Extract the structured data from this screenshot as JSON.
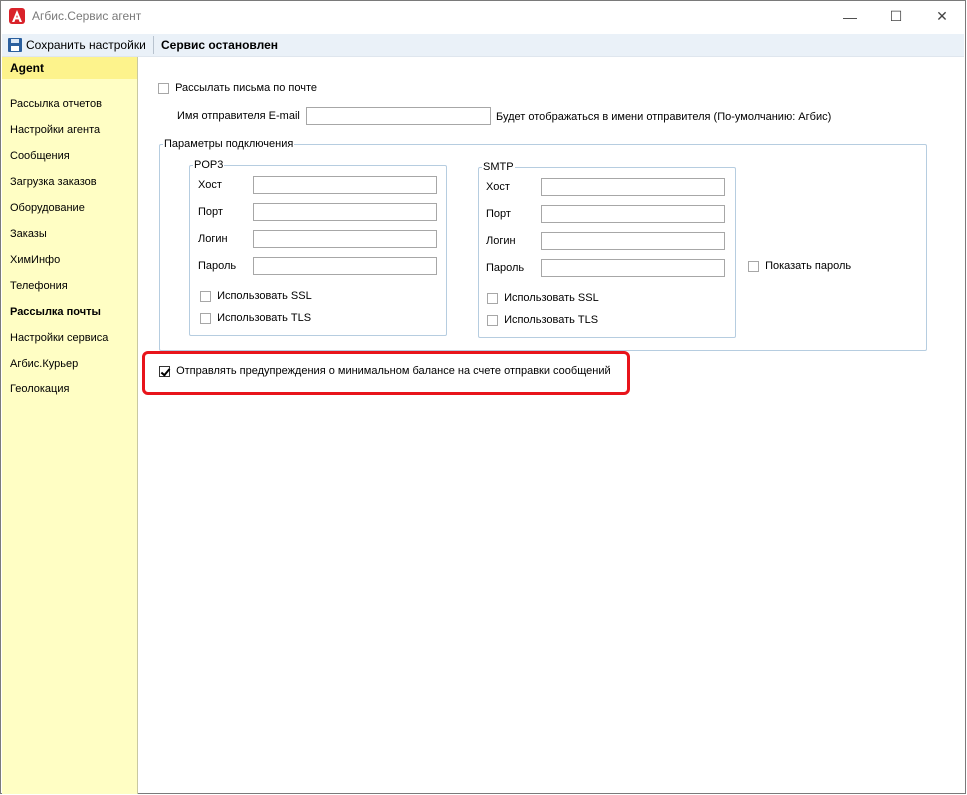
{
  "window": {
    "title": "Агбис.Сервис агент",
    "minimize_glyph": "—",
    "maximize_glyph": "☐",
    "close_glyph": "✕"
  },
  "toolbar": {
    "save_label": "Сохранить настройки",
    "status": "Сервис остановлен"
  },
  "sidebar": {
    "header": "Agent",
    "items": [
      {
        "label": "Рассылка отчетов"
      },
      {
        "label": "Настройки агента"
      },
      {
        "label": "Сообщения"
      },
      {
        "label": "Загрузка заказов"
      },
      {
        "label": "Оборудование"
      },
      {
        "label": "Заказы"
      },
      {
        "label": "ХимИнфо"
      },
      {
        "label": "Телефония"
      },
      {
        "label": "Рассылка почты",
        "active": true
      },
      {
        "label": "Настройки сервиса"
      },
      {
        "label": "Агбис.Курьер"
      },
      {
        "label": "Геолокация"
      }
    ]
  },
  "mail": {
    "send_mail_label": "Рассылать письма по почте",
    "send_mail_checked": false,
    "sender_name_label": "Имя отправителя E-mail",
    "sender_name_value": "",
    "sender_hint": "Будет отображаться в имени отправителя (По-умолчанию: Агбис)",
    "connection_group": "Параметры подключения",
    "pop3": {
      "title": "POP3",
      "host_label": "Хост",
      "host_value": "",
      "port_label": "Порт",
      "port_value": "",
      "login_label": "Логин",
      "login_value": "",
      "password_label": "Пароль",
      "password_value": "",
      "ssl_label": "Использовать SSL",
      "ssl_checked": false,
      "tls_label": "Использовать TLS",
      "tls_checked": false
    },
    "smtp": {
      "title": "SMTP",
      "host_label": "Хост",
      "host_value": "",
      "port_label": "Порт",
      "port_value": "",
      "login_label": "Логин",
      "login_value": "",
      "password_label": "Пароль",
      "password_value": "",
      "ssl_label": "Использовать SSL",
      "ssl_checked": false,
      "tls_label": "Использовать TLS",
      "tls_checked": false
    },
    "show_password_label": "Показать пароль",
    "show_password_checked": false,
    "min_balance_label": "Отправлять предупреждения о минимальном балансе на счете отправки сообщений",
    "min_balance_checked": true
  },
  "colors": {
    "sidebar_bg": "#fffec4",
    "sidebar_header_bg": "#fdf38c",
    "toolbar_bg": "#eaf1f8",
    "highlight_border": "#e8141b",
    "group_border": "#b6cde0"
  }
}
